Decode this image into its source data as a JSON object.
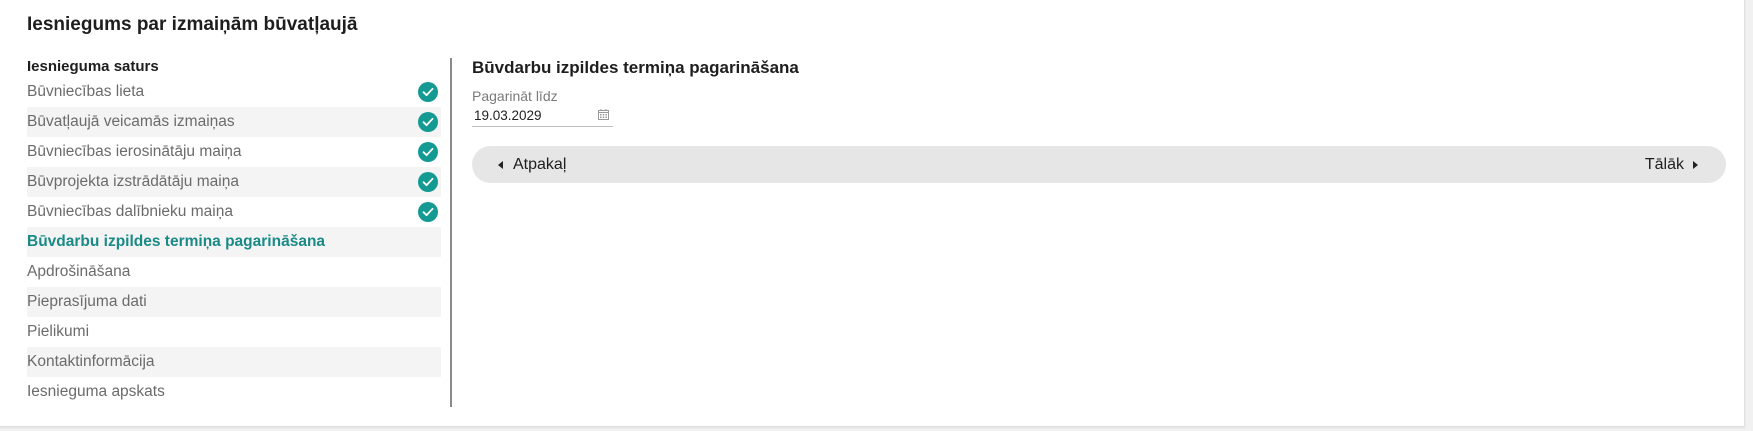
{
  "page": {
    "title": "Iesniegums par izmaiņām būvatļaujā"
  },
  "sidebar": {
    "heading": "Iesnieguma saturs",
    "items": [
      {
        "label": "Būvniecības lieta",
        "done": true
      },
      {
        "label": "Būvatļaujā veicamās izmaiņas",
        "done": true
      },
      {
        "label": "Būvniecības ierosinātāju maiņa",
        "done": true
      },
      {
        "label": "Būvprojekta izstrādātāju maiņa",
        "done": true
      },
      {
        "label": "Būvniecības dalībnieku maiņa",
        "done": true
      },
      {
        "label": "Būvdarbu izpildes termiņa pagarināšana",
        "active": true
      },
      {
        "label": "Apdrošināšana"
      },
      {
        "label": "Pieprasījuma dati"
      },
      {
        "label": "Pielikumi"
      },
      {
        "label": "Kontaktinformācija"
      },
      {
        "label": "Iesnieguma apskats"
      }
    ]
  },
  "main": {
    "section_title": "Būvdarbu izpildes termiņa pagarināšana",
    "extend_until": {
      "label": "Pagarināt līdz",
      "value": "19.03.2029",
      "icon": "calendar-icon"
    },
    "nav": {
      "back_label": "Atpakaļ",
      "next_label": "Tālāk"
    }
  },
  "colors": {
    "accent": "#139a93",
    "active_text": "#1a8a86",
    "nav_bar_bg": "#e6e6e6"
  }
}
